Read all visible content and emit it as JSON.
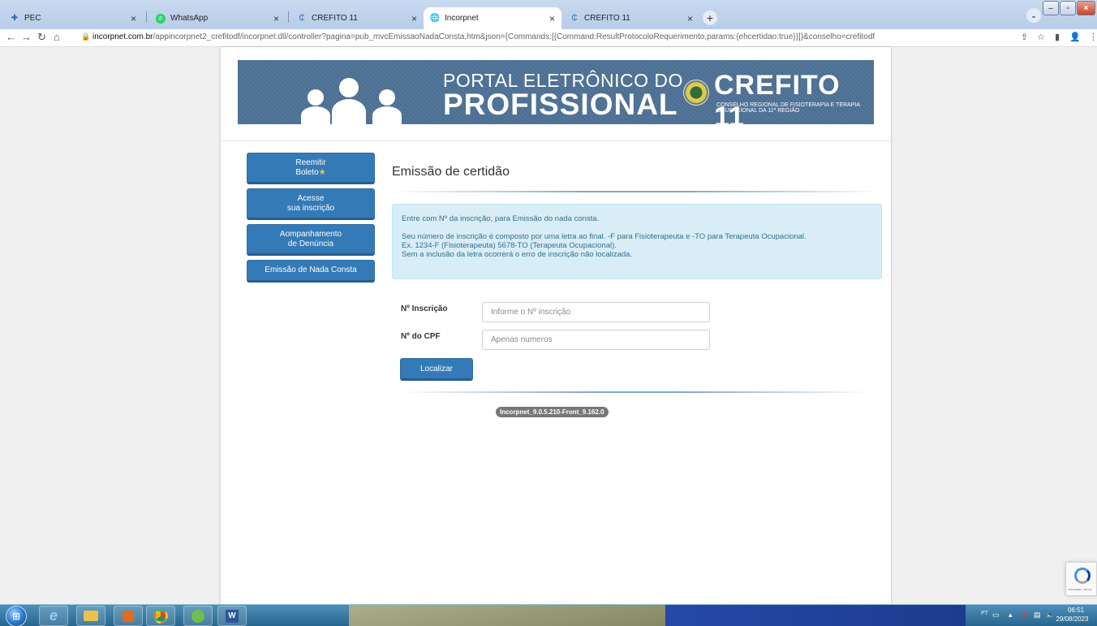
{
  "browser": {
    "tabs": [
      {
        "title": "PEC",
        "icon": "pec-icon",
        "active": false
      },
      {
        "title": "WhatsApp",
        "icon": "whatsapp-icon",
        "active": false
      },
      {
        "title": "CREFITO 11",
        "icon": "crefito-icon",
        "active": false
      },
      {
        "title": "Incorpnet",
        "icon": "globe-icon",
        "active": true
      },
      {
        "title": "CREFITO 11",
        "icon": "crefito-icon",
        "active": false
      }
    ],
    "new_tab": "+",
    "url_host": "incorpnet.com.br",
    "url_rest": "/appincorpnet2_crefitodf/incorpnet.dll/controller?pagina=pub_mvcEmissaoNadaConsta.htm&json={Commands:[{Command:ResultProtocoloRequerimento,params:{ehcertidao:true}}]}&conselho=crefitodf"
  },
  "banner": {
    "line1": "PORTAL ELETRÔNICO DO",
    "line2": "PROFISSIONAL",
    "brand": "CREFITO 11",
    "brand_sub": "CONSELHO REGIONAL DE FISIOTERAPIA E TERAPIA OCUPACIONAL DA 11ª REGIÃO"
  },
  "sidebar": {
    "items": [
      {
        "line1": "Reemitir",
        "line2": "Boleto",
        "star": "★"
      },
      {
        "line1": "Acesse",
        "line2": "sua inscrição"
      },
      {
        "line1": "Aompanhamento",
        "line2": "de Denúncia"
      },
      {
        "line1": "Emissão de Nada Consta"
      }
    ]
  },
  "main": {
    "title": "Emissão de certidão",
    "info": {
      "line1": "Entre com Nº da inscrição, para Emissão do nada consta.",
      "line2": "Seu número de inscrição é composto por uma letra ao final. -F para Fisioterapeuta e -TO para Terapeuta Ocupacional.",
      "line3": "Ex. 1234-F (Fisioterapeuta) 5678-TO (Terapeuta Ocupacional).",
      "line4": "Sem a inclusão da letra ocorrerá o erro de inscrição não localizada."
    },
    "form": {
      "inscricao_label": "Nº Inscrição",
      "inscricao_placeholder": "Informe o Nº inscrição",
      "inscricao_value": "",
      "cpf_label": "Nº do CPF",
      "cpf_placeholder": "Apenas numeros",
      "cpf_value": "",
      "submit_label": "Localizar"
    },
    "version": "Incorpnet_9.0.5.210-Front_9.162.0"
  },
  "recaptcha": {
    "text": "Privacidade - Termos"
  },
  "taskbar": {
    "lang": "PT",
    "time": "06:51",
    "date": "29/08/2023"
  },
  "colors": {
    "primary": "#337ab7",
    "info_bg": "#d9edf7",
    "info_text": "#31708f",
    "banner_bg": "#4b6f93"
  }
}
